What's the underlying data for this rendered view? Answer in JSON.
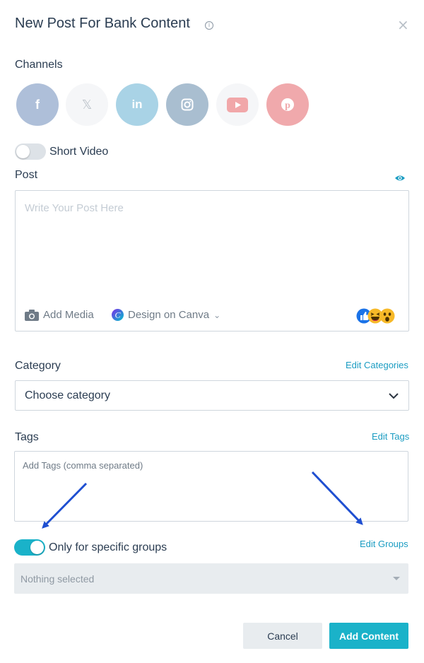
{
  "header": {
    "title": "New Post For Bank Content",
    "info_icon": "info-icon",
    "close_icon": "close-icon"
  },
  "channels": {
    "label": "Channels",
    "items": [
      {
        "name": "facebook",
        "glyph": "f",
        "color": "#aebfd9"
      },
      {
        "name": "x",
        "glyph": "𝕏",
        "color": "#f5f6f8"
      },
      {
        "name": "linkedin",
        "glyph": "in",
        "color": "#a9d3e6"
      },
      {
        "name": "instagram",
        "glyph": "◎",
        "color": "#a9bed0"
      },
      {
        "name": "youtube",
        "glyph": "▶",
        "color": "#f5f6f8"
      },
      {
        "name": "pinterest",
        "glyph": "P",
        "color": "#f0a9ac"
      }
    ]
  },
  "short_video": {
    "label": "Short Video",
    "on": false
  },
  "post": {
    "label": "Post",
    "placeholder": "Write Your Post Here",
    "add_media": "Add Media",
    "design_canva": "Design on Canva",
    "preview_icon": "eye-icon"
  },
  "category": {
    "label": "Category",
    "edit_link": "Edit Categories",
    "selected": "Choose category"
  },
  "tags": {
    "label": "Tags",
    "edit_link": "Edit Tags",
    "placeholder": "Add Tags (comma separated)"
  },
  "groups": {
    "label": "Only for specific groups",
    "on": true,
    "edit_link": "Edit Groups",
    "selected": "Nothing selected"
  },
  "footer": {
    "cancel": "Cancel",
    "add": "Add Content"
  },
  "colors": {
    "accent": "#1ab2c9",
    "link": "#1a9cc2",
    "arrow": "#1f4fd1"
  }
}
